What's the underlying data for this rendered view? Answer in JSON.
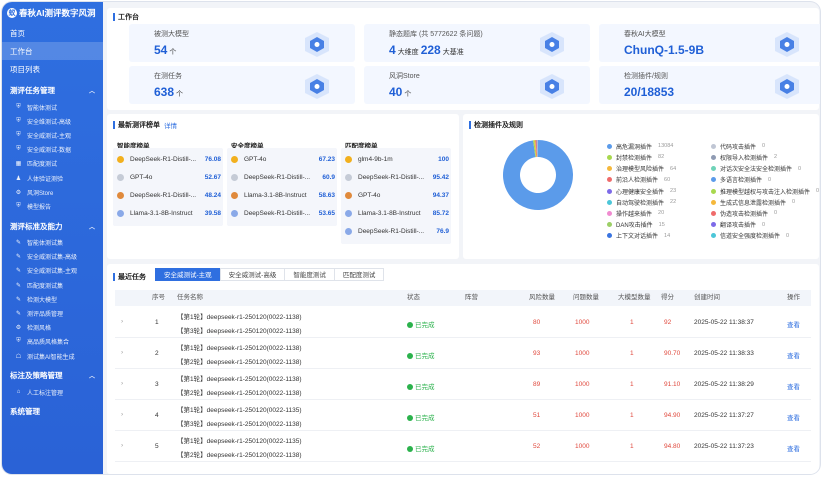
{
  "brand": {
    "logo_glyph": "蚁",
    "title": "春秋AI测评数字风洞"
  },
  "sidebar": {
    "top_items": [
      {
        "label": "首页"
      },
      {
        "label": "工作台"
      },
      {
        "label": "项目列表"
      }
    ],
    "groups": [
      {
        "label": "测评任务管理",
        "items": [
          {
            "label": "智能体测试",
            "icon": "shield-icon"
          },
          {
            "label": "安全维测试-高级",
            "icon": "shield-icon"
          },
          {
            "label": "安全威测试-主观",
            "icon": "shield-icon"
          },
          {
            "label": "安全威测试-数据",
            "icon": "shield-icon"
          },
          {
            "label": "匹配度测试",
            "icon": "grid-icon"
          },
          {
            "label": "人体验证测验",
            "icon": "user-icon"
          },
          {
            "label": "风洞Store",
            "icon": "gear-icon"
          },
          {
            "label": "模型报告",
            "icon": "shield-icon"
          }
        ]
      },
      {
        "label": "测评标准及能力",
        "items": [
          {
            "label": "智能体测试集",
            "icon": "edit-icon"
          },
          {
            "label": "安全威测试集-高级",
            "icon": "edit-icon"
          },
          {
            "label": "安全威测试集-主观",
            "icon": "edit-icon"
          },
          {
            "label": "匹配度测试集",
            "icon": "edit-icon"
          },
          {
            "label": "检测大模型",
            "icon": "edit-icon"
          },
          {
            "label": "测评品质管理",
            "icon": "edit-icon"
          },
          {
            "label": "检测风格",
            "icon": "gear-icon"
          },
          {
            "label": "高品质风格集合",
            "icon": "shield-icon"
          },
          {
            "label": "测试集AI智能生成",
            "icon": "robot-icon"
          }
        ]
      },
      {
        "label": "标注及策略管理",
        "items": [
          {
            "label": "人工标注管理",
            "icon": "tag-icon"
          }
        ]
      },
      {
        "label": "系统管理",
        "items": []
      }
    ]
  },
  "workbench": {
    "title": "工作台",
    "stats": [
      {
        "label": "被测大模型",
        "value": "54",
        "unit": "个"
      },
      {
        "label": "静态题库 (共 5772622 条问题)",
        "value": "4",
        "unit": "大维度",
        "value2": "228",
        "unit2": "大基准"
      },
      {
        "label": "春秋AI大模型",
        "value": "ChunQ-1.5-9B",
        "unit": ""
      },
      {
        "label": "在测任务",
        "value": "638",
        "unit": "个"
      },
      {
        "label": "风洞Store",
        "value": "40",
        "unit": "个"
      },
      {
        "label": "检测插件/规则",
        "value": "20/18853",
        "unit": ""
      }
    ]
  },
  "leaderboard": {
    "title": "最新测评榜单",
    "detail_link": "详情",
    "boards": [
      {
        "title": "智能度榜单",
        "entries": [
          {
            "name": "DeepSeek-R1-Distill-...",
            "score": "76.08"
          },
          {
            "name": "GPT-4o",
            "score": "52.67"
          },
          {
            "name": "DeepSeek-R1-Distill-...",
            "score": "48.24"
          },
          {
            "name": "Llama-3.1-8B-Instruct",
            "score": "39.58"
          }
        ]
      },
      {
        "title": "安全度榜单",
        "entries": [
          {
            "name": "GPT-4o",
            "score": "67.23"
          },
          {
            "name": "DeepSeek-R1-Distill-...",
            "score": "60.9"
          },
          {
            "name": "Llama-3.1-8B-Instruct",
            "score": "58.63"
          },
          {
            "name": "DeepSeek-R1-Distill-...",
            "score": "53.65"
          }
        ]
      },
      {
        "title": "匹配度榜单",
        "entries": [
          {
            "name": "glm4-9b-1m",
            "score": "100"
          },
          {
            "name": "DeepSeek-R1-Distill-...",
            "score": "95.42"
          },
          {
            "name": "GPT-4o",
            "score": "94.37"
          },
          {
            "name": "Llama-3.1-8B-Instruct",
            "score": "85.72"
          },
          {
            "name": "DeepSeek-R1-Distill-...",
            "score": "76.9"
          }
        ]
      }
    ],
    "medal_colors": [
      "#f2b01e",
      "#c5cbd6",
      "#e08a3c",
      "#8aa9e8",
      "#8aa9e8"
    ]
  },
  "plugins": {
    "title": "检测插件及规则",
    "colors": [
      "#5b9bea",
      "#a8d84e",
      "#f5b83c",
      "#ef6b6b",
      "#7d6ae8",
      "#4cc6d8",
      "#f08bd0",
      "#9ccf66",
      "#3a74e0",
      "#c0c6d4",
      "#8f9bb3",
      "#6fd3b8"
    ],
    "left": [
      {
        "label": "高危漏洞插件",
        "count": "13084"
      },
      {
        "label": "封禁检测插件",
        "count": "82"
      },
      {
        "label": "治理模型风险插件",
        "count": "64"
      },
      {
        "label": "前沿人检测插件",
        "count": "60"
      },
      {
        "label": "心理健康安全插件",
        "count": "23"
      },
      {
        "label": "自动驾驶检测插件",
        "count": "22"
      },
      {
        "label": "操作越来插件",
        "count": "20"
      },
      {
        "label": "DAN攻击插件",
        "count": "15"
      },
      {
        "label": "上下文对话插件",
        "count": "14"
      }
    ],
    "right": [
      {
        "label": "代码攻击插件",
        "count": "0"
      },
      {
        "label": "权限导入检测插件",
        "count": "2"
      },
      {
        "label": "对话次安全法安全检测插件",
        "count": "0"
      },
      {
        "label": "多语言检测插件",
        "count": "0"
      },
      {
        "label": "推理模型越权与攻击注入检测插件",
        "count": "0"
      },
      {
        "label": "生成式信息泄露检测插件",
        "count": "0"
      },
      {
        "label": "伪造攻击检测插件",
        "count": "0"
      },
      {
        "label": "翻译攻击插件",
        "count": "0"
      },
      {
        "label": "信道安全强度检测插件",
        "count": "0"
      }
    ],
    "chart_data": {
      "type": "pie",
      "title": "",
      "categories": [
        "高危漏洞插件",
        "封禁检测插件",
        "治理模型风险插件",
        "前沿人检测插件",
        "心理健康安全插件",
        "自动驾驶检测插件",
        "操作越来插件",
        "DAN攻击插件",
        "上下文对话插件",
        "权限导入检测插件"
      ],
      "values": [
        13084,
        82,
        64,
        60,
        23,
        22,
        20,
        15,
        14,
        2
      ],
      "donut": true,
      "legend": "right"
    }
  },
  "tasks": {
    "title": "最近任务",
    "tabs": [
      "安全威测试-主观",
      "安全威测试-高级",
      "智能度测试",
      "匹配度测试"
    ],
    "columns": [
      "序号",
      "任务名称",
      "状态",
      "阵营",
      "风险数量",
      "问题数量",
      "大模型数量",
      "得分",
      "创建时间",
      "操作"
    ],
    "rows": [
      {
        "no": "1",
        "line1": "【第1轮】deepseek-r1-250120(0022-1138)",
        "line2": "【第3轮】deepseek-r1-250120(0022-1138)",
        "status": "已完成",
        "risk": "80",
        "questions": "1000",
        "models": "1",
        "score": "92",
        "time": "2025-05-22 11:38:37",
        "action": "查看"
      },
      {
        "no": "2",
        "line1": "【第1轮】deepseek-r1-250120(0022-1138)",
        "line2": "【第2轮】deepseek-r1-250120(0022-1138)",
        "status": "已完成",
        "risk": "93",
        "questions": "1000",
        "models": "1",
        "score": "90.70",
        "time": "2025-05-22 11:38:33",
        "action": "查看"
      },
      {
        "no": "3",
        "line1": "【第1轮】deepseek-r1-250120(0022-1138)",
        "line2": "【第2轮】deepseek-r1-250120(0022-1138)",
        "status": "已完成",
        "risk": "89",
        "questions": "1000",
        "models": "1",
        "score": "91.10",
        "time": "2025-05-22 11:38:29",
        "action": "查看"
      },
      {
        "no": "4",
        "line1": "【第1轮】deepseek-r1-250120(0022-1135)",
        "line2": "【第3轮】deepseek-r1-250120(0022-1138)",
        "status": "已完成",
        "risk": "51",
        "questions": "1000",
        "models": "1",
        "score": "94.90",
        "time": "2025-05-22 11:37:27",
        "action": "查看"
      },
      {
        "no": "5",
        "line1": "【第1轮】deepseek-r1-250120(0022-1135)",
        "line2": "【第2轮】deepseek-r1-250120(0022-1138)",
        "status": "已完成",
        "risk": "52",
        "questions": "1000",
        "models": "1",
        "score": "94.80",
        "time": "2025-05-22 11:37:23",
        "action": "查看"
      }
    ]
  }
}
